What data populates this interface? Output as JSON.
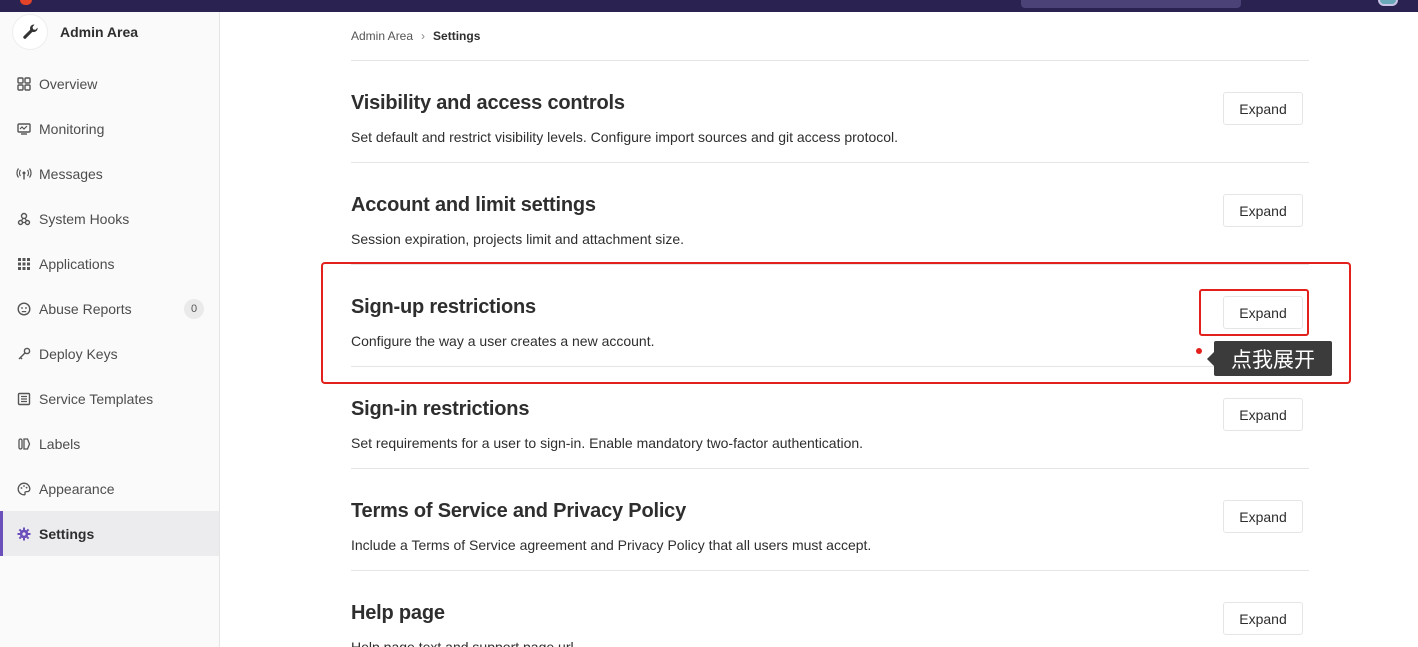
{
  "sidebar": {
    "title": "Admin Area",
    "items": [
      {
        "label": "Overview",
        "icon": "overview-icon"
      },
      {
        "label": "Monitoring",
        "icon": "monitor-icon"
      },
      {
        "label": "Messages",
        "icon": "broadcast-icon"
      },
      {
        "label": "System Hooks",
        "icon": "hook-icon"
      },
      {
        "label": "Applications",
        "icon": "applications-grid-icon"
      },
      {
        "label": "Abuse Reports",
        "icon": "abuse-face-icon",
        "badge": "0"
      },
      {
        "label": "Deploy Keys",
        "icon": "key-icon"
      },
      {
        "label": "Service Templates",
        "icon": "template-icon"
      },
      {
        "label": "Labels",
        "icon": "label-icon"
      },
      {
        "label": "Appearance",
        "icon": "palette-icon"
      },
      {
        "label": "Settings",
        "icon": "gear-icon",
        "active": true
      }
    ]
  },
  "breadcrumb": {
    "parent": "Admin Area",
    "current": "Settings"
  },
  "sections": [
    {
      "title": "Visibility and access controls",
      "description": "Set default and restrict visibility levels. Configure import sources and git access protocol.",
      "button": "Expand"
    },
    {
      "title": "Account and limit settings",
      "description": "Session expiration, projects limit and attachment size.",
      "button": "Expand"
    },
    {
      "title": "Sign-up restrictions",
      "description": "Configure the way a user creates a new account.",
      "button": "Expand"
    },
    {
      "title": "Sign-in restrictions",
      "description": "Set requirements for a user to sign-in. Enable mandatory two-factor authentication.",
      "button": "Expand"
    },
    {
      "title": "Terms of Service and Privacy Policy",
      "description": "Include a Terms of Service agreement and Privacy Policy that all users must accept.",
      "button": "Expand"
    },
    {
      "title": "Help page",
      "description": "Help page text and support page url.",
      "button": "Expand"
    }
  ],
  "annotation": {
    "tooltip": "点我展开",
    "color": "#e3211c"
  },
  "colors": {
    "topbar": "#2a2250",
    "accent": "#6b4fbb"
  }
}
